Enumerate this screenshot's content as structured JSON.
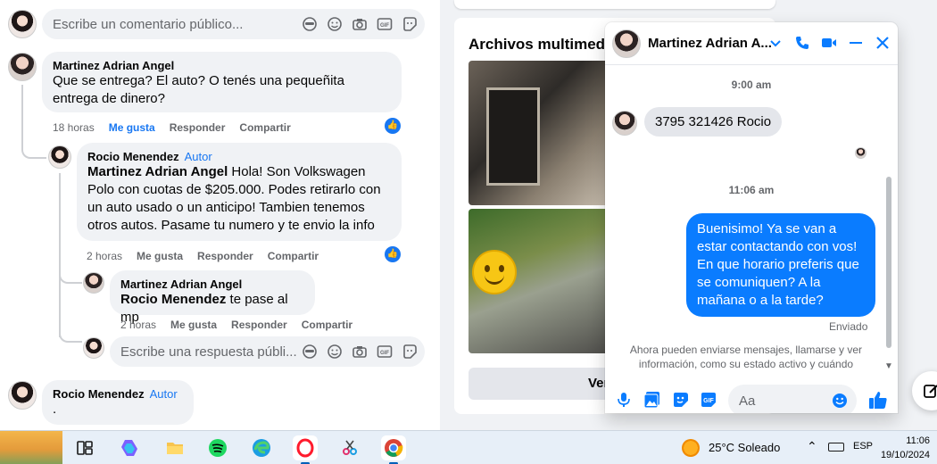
{
  "top_comment_box": {
    "placeholder": "Escribe un comentario público..."
  },
  "comments": [
    {
      "author": "Martinez Adrian Angel",
      "text": "Que se entrega? El auto? O tenés una pequeñita entrega de dinero?",
      "time": "18 horas",
      "like": "Me gusta",
      "reply": "Responder",
      "share": "Compartir"
    },
    {
      "author": "Rocio Menendez",
      "badge": "Autor",
      "mention": "Martinez Adrian Angel",
      "text": " Hola! Son Volkswagen Polo con cuotas de $205.000. Podes retirarlo con un auto usado o un anticipo! Tambien tenemos otros autos. Pasame tu numero y te envio la info",
      "time": "2 horas",
      "like": "Me gusta",
      "reply": "Responder",
      "share": "Compartir"
    },
    {
      "author": "Martinez Adrian Angel",
      "mention": "Rocio Menendez",
      "text": " te pase al mp",
      "time": "2 horas",
      "like": "Me gusta",
      "reply": "Responder",
      "share": "Compartir"
    },
    {
      "author": "Rocio Menendez",
      "badge": "Autor",
      "text": "."
    }
  ],
  "reply_box": {
    "placeholder": "Escribe una respuesta públi..."
  },
  "media": {
    "title": "Archivos multimedia",
    "button": "Ver"
  },
  "messenger": {
    "contact": "Martinez Adrian A...",
    "time1": "9:00 am",
    "incoming": "3795 321426 Rocio",
    "time2": "11:06 am",
    "outgoing": "Buenisimo! Ya se van a estar contactando con vos! En que horario preferis que se comuniquen? A la mañana o a la tarde?",
    "status": "Enviado",
    "notice": "Ahora pueden enviarse mensajes, llamarse y ver información, como su estado activo y cuándo",
    "input_placeholder": "Aa"
  },
  "taskbar": {
    "weather": "25°C  Soleado",
    "lang": "ESP",
    "time": "11:06",
    "date": "19/10/2024"
  },
  "colors": {
    "facebook_blue": "#1877f2",
    "messenger_blue": "#0a7cff",
    "comment_bg": "#f0f2f5"
  }
}
